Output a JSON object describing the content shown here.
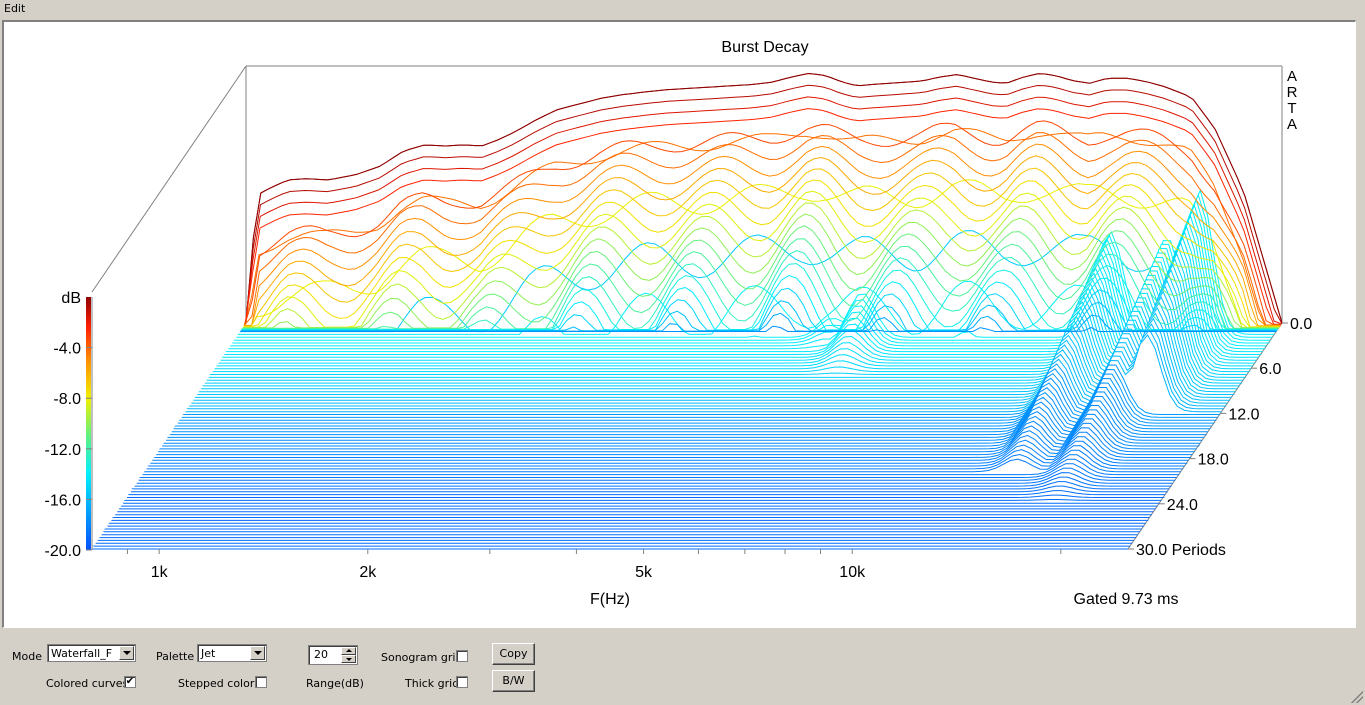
{
  "menu": {
    "edit_label": "Edit"
  },
  "chart_data": {
    "type": "waterfall",
    "title": "Burst Decay",
    "watermark": "ARTA",
    "xlabel": "F(Hz)",
    "x_scale": "log",
    "x_range_hz": [
      800,
      25000
    ],
    "x_tick_labels": [
      {
        "hz": 1000,
        "label": "1k"
      },
      {
        "hz": 2000,
        "label": "2k"
      },
      {
        "hz": 5000,
        "label": "5k"
      },
      {
        "hz": 10000,
        "label": "10k"
      }
    ],
    "x_minor_ticks_hz": [
      900,
      3000,
      4000,
      6000,
      7000,
      8000,
      9000,
      20000
    ],
    "z_label": "Periods",
    "z_range": [
      0,
      30
    ],
    "z_tick_labels": [
      "0.0",
      "6.0",
      "12.0",
      "18.0",
      "24.0",
      "30.0 Periods"
    ],
    "z_ticks": [
      0,
      6,
      12,
      18,
      24,
      30
    ],
    "colorbar": {
      "label": "dB",
      "range_db": [
        -20,
        0
      ],
      "tick_labels": [
        "-4.0",
        "-8.0",
        "-12.0",
        "-16.0",
        "-20.0"
      ],
      "ticks_db": [
        -4,
        -8,
        -12,
        -16,
        -20
      ],
      "palette": "Jet"
    },
    "gate_annotation": "Gated 9.73 ms",
    "num_slices": 80,
    "front_slice_profile": {
      "freq_hz": [
        800,
        830,
        870,
        920,
        980,
        1050,
        1150,
        1250,
        1350,
        1450,
        1550,
        1650,
        1750,
        1850,
        1950,
        2100,
        2250,
        2400,
        2600,
        2800,
        3000,
        3250,
        3500,
        3750,
        4000,
        4300,
        4600,
        4900,
        5200,
        5500,
        5800,
        6100,
        6400,
        6800,
        7200,
        7600,
        8000,
        8500,
        9000,
        9500,
        10000,
        10600,
        11200,
        11800,
        12500,
        13200,
        14000,
        15000,
        16000,
        17000,
        18500,
        20000,
        22000,
        25000
      ],
      "level_db": [
        -20,
        -9.8,
        -9.2,
        -8.6,
        -8.5,
        -8.6,
        -8.2,
        -7.5,
        -6.3,
        -5.8,
        -5.9,
        -5.8,
        -5.9,
        -5.4,
        -4.8,
        -3.8,
        -3.0,
        -2.6,
        -2.1,
        -1.8,
        -1.6,
        -1.4,
        -1.3,
        -1.2,
        -1.1,
        -1.0,
        -0.8,
        -0.4,
        -0.1,
        -0.3,
        -0.8,
        -1.1,
        -1.0,
        -0.9,
        -0.8,
        -0.7,
        -0.4,
        -0.2,
        -0.5,
        -0.8,
        -0.9,
        -0.4,
        -0.1,
        -0.3,
        -0.7,
        -0.9,
        -0.5,
        -0.5,
        -0.8,
        -1.2,
        -2.0,
        -4.5,
        -9.5,
        -20
      ]
    },
    "resonance_peaks": [
      {
        "freq_hz": 5800,
        "level_db": -17.2,
        "persist_periods": 6
      },
      {
        "freq_hz": 6400,
        "level_db": -15.5,
        "persist_periods": 8
      },
      {
        "freq_hz": 14500,
        "level_db": -11.5,
        "persist_periods": 20
      },
      {
        "freq_hz": 17500,
        "level_db": -12.0,
        "persist_periods": 26
      },
      {
        "freq_hz": 19500,
        "level_db": -8.0,
        "persist_periods": 12
      }
    ]
  },
  "controls": {
    "mode_label": "Mode",
    "mode_value": "Waterfall_F",
    "palette_label": "Palette",
    "palette_value": "Jet",
    "range_value": "20",
    "range_label": "Range(dB)",
    "sonogram_grid_label": "Sonogram grid",
    "sonogram_grid_checked": false,
    "thick_grid_label": "Thick grid",
    "thick_grid_checked": false,
    "colored_curves_label": "Colored curves",
    "colored_curves_checked": true,
    "stepped_colors_label": "Stepped colors",
    "stepped_colors_checked": false,
    "copy_label": "Copy",
    "bw_label": "B/W"
  }
}
